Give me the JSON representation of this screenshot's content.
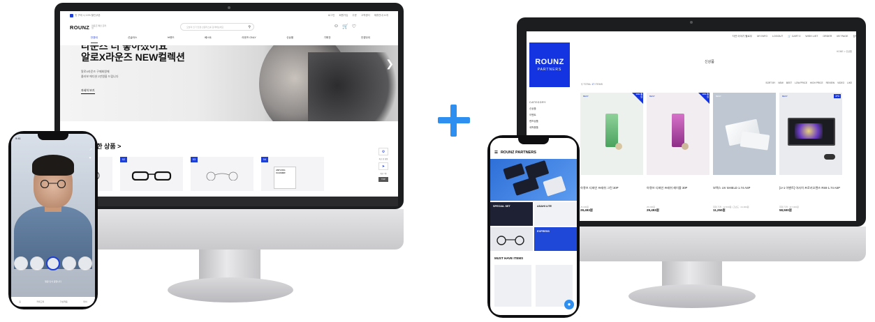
{
  "left_desktop": {
    "promo_text": "첫 구매 시 10% 할인쿠폰",
    "top_links": [
      "로그인",
      "회원가입",
      "주문",
      "고객센터",
      "제휴안내 소개"
    ],
    "logo": "ROUNZ",
    "logo_sub": "라운즈 메인 프라임",
    "search_placeholder": "오늘의 인기 안경·선글라스를 검색해보세요",
    "nav": [
      "안경테",
      "선글라스",
      "브랜드",
      "베스트",
      "라운즈 ONLY",
      "신상품",
      "기획전",
      "안경닦이"
    ],
    "hero": {
      "title_cut": "라운즈 더 좋아졌어요",
      "title": "알로X라운즈 NEW컬렉션",
      "sub_lines": [
        "알로X라운즈 구매회원께",
        "콜라보 에디션 2만원을 드립니다"
      ],
      "button": "자세히 보기"
    },
    "section_title": "요즘 핫한 상품 >",
    "section_title_visible": "핫한 상품",
    "cards": [
      {
        "badge": "01"
      },
      {
        "badge": "02"
      },
      {
        "badge": "03"
      },
      {
        "badge": "04",
        "label": "ANTI-FOG CLEANER"
      }
    ],
    "side_labels": [
      "최근 본 상품",
      "위로 / 찜",
      "TOP"
    ]
  },
  "left_phone": {
    "status_time": "9:41",
    "caption": "얼굴 인식 중입니다",
    "tabs": [
      "홈",
      "카테고리",
      "가상착용",
      "마이"
    ]
  },
  "right_desktop": {
    "top_links": [
      "자연 이야기 헬로우",
      "MY INFO",
      "LOGOUT",
      "CART",
      "WISH LIST",
      "ORDER",
      "MY PAGE",
      "검색"
    ],
    "cart_count": "0",
    "logo_main": "ROUNZ",
    "logo_sub": "PARTNERS",
    "breadcrumb": "HOME > 신상품",
    "page_title": "신상품",
    "total_label": "TOTAL",
    "total_count": "17",
    "total_unit": "ITEMS",
    "sort_options": [
      "SORT BY",
      "NEW",
      "BEST",
      "LOW PRICE",
      "HIGH PRICE",
      "REVIEW",
      "VIDEO",
      "LIKE"
    ],
    "category_title": "CATEGORY",
    "categories": [
      "신상품",
      "이벤트",
      "렌즈상품",
      "세척용품"
    ],
    "products": [
      {
        "tag": "BEST",
        "corner": "10% 할인",
        "name": "아큐브 디파인 프레쉬 그린 30P",
        "small": "25,000원",
        "price": "29,493원",
        "theme": "green"
      },
      {
        "tag": "BEST",
        "corner": "10% 할인",
        "name": "아큐브 디파인 프레쉬 헤이즐 30P",
        "small": "25,000원",
        "price": "29,493원",
        "theme": "purple"
      },
      {
        "tag": "BEST",
        "corner": "",
        "name": "보택스 UV SHIELD 1.74 ASP",
        "small": "최대 가격 : 12,500원 | 고난도 : 24,000원",
        "price": "11,250원",
        "theme": "lens"
      },
      {
        "tag": "BEST",
        "corner": "1+1",
        "name": "[1+1 이벤트] 아사히 프로키오렌즈 RS9 1.74 ASP",
        "small": "최대 가격 : 117,000원",
        "price": "58,500원",
        "theme": "screen"
      }
    ]
  },
  "right_phone": {
    "header": "ROUNZ PARTNERS",
    "tiles": [
      {
        "label": "SPECIAL SET"
      },
      {
        "label": "ASAHI LITE"
      },
      {
        "label": ""
      },
      {
        "label": "EXPRESS"
      }
    ],
    "must_have": "MUST HAVE ITEMS"
  },
  "colors": {
    "brand_blue": "#1334e0",
    "plus_blue": "#2f8ff0",
    "device_black": "#1c1d1f"
  }
}
